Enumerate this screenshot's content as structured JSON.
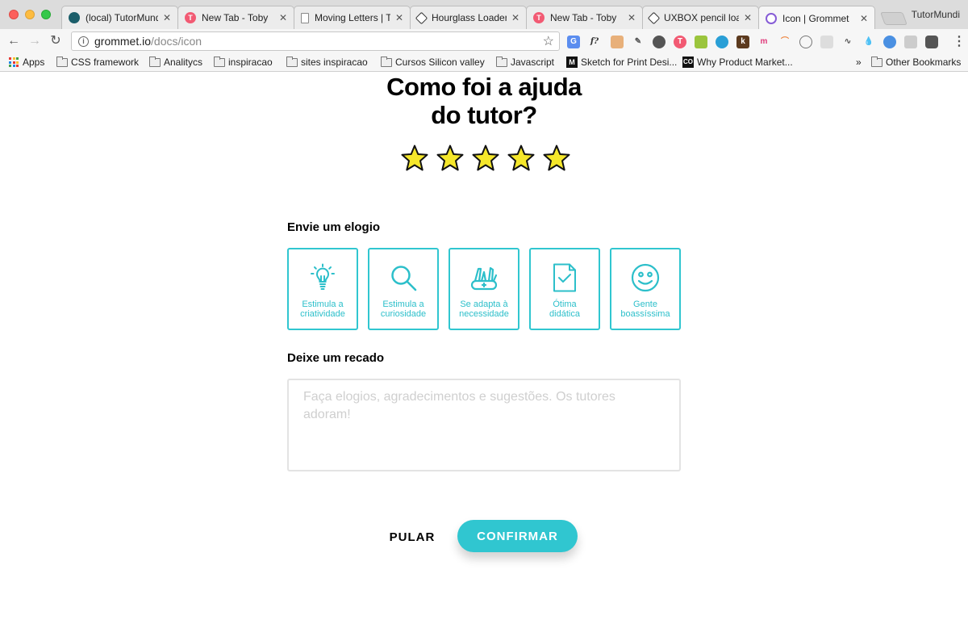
{
  "browser": {
    "tabs": [
      {
        "title": "(local) TutorMundi",
        "favicon_color": "#1b5e6a",
        "favicon": "tutormundi-favicon",
        "active": false
      },
      {
        "title": "New Tab - Toby",
        "favicon_color": "#f25a73",
        "favicon": "toby-favicon",
        "active": false
      },
      {
        "title": "Moving Letters | T",
        "favicon_color": "#888888",
        "favicon": "page-favicon",
        "active": false
      },
      {
        "title": "Hourglass Loader",
        "favicon_color": "#333333",
        "favicon": "codepen-favicon",
        "active": false
      },
      {
        "title": "New Tab - Toby",
        "favicon_color": "#f25a73",
        "favicon": "toby-favicon",
        "active": false
      },
      {
        "title": "UXBOX pencil loa",
        "favicon_color": "#333333",
        "favicon": "codepen-favicon",
        "active": false
      },
      {
        "title": "Icon | Grommet",
        "favicon_color": "#865cd6",
        "favicon": "grommet-favicon",
        "active": true
      }
    ],
    "profile_name": "TutorMundi",
    "url_host": "grommet.io",
    "url_path": "/docs/icon",
    "bookmarks": [
      {
        "label": "Apps",
        "icon": "apps-grid-icon"
      },
      {
        "label": "CSS framework",
        "icon": "folder-icon"
      },
      {
        "label": "Analitycs",
        "icon": "folder-icon"
      },
      {
        "label": "inspiracao",
        "icon": "folder-icon"
      },
      {
        "label": "sites inspiracao",
        "icon": "folder-icon"
      },
      {
        "label": "Cursos Silicon valley",
        "icon": "folder-icon"
      },
      {
        "label": "Javascript",
        "icon": "folder-icon"
      },
      {
        "label": "Sketch for Print Desi...",
        "icon": "medium-icon",
        "badge": "M"
      },
      {
        "label": "Why Product Market...",
        "icon": "co-icon",
        "badge": "CO"
      }
    ],
    "overflow": "»",
    "other_bookmarks": "Other Bookmarks"
  },
  "rating": {
    "heading_line1": "Como foi a ajuda",
    "heading_line2": "do tutor?",
    "stars": 5,
    "max_stars": 5,
    "star_color": "#f5e72b"
  },
  "compliments": {
    "label": "Envie um elogio",
    "accent_color": "#30c6d0",
    "items": [
      {
        "line1": "Estimula a",
        "line2": "criatividade",
        "icon": "lightbulb-icon"
      },
      {
        "line1": "Estimula a",
        "line2": "curiosidade",
        "icon": "search-icon"
      },
      {
        "line1": "Se adapta à",
        "line2": "necessidade",
        "icon": "swiss-knife-icon"
      },
      {
        "line1": "Ótima",
        "line2": "didática",
        "icon": "document-check-icon"
      },
      {
        "line1": "Gente",
        "line2": "boassíssima",
        "icon": "smiley-icon"
      }
    ]
  },
  "message": {
    "label": "Deixe um recado",
    "placeholder": "Faça elogios, agradecimentos e sugestões. Os tutores adoram!",
    "value": ""
  },
  "actions": {
    "skip_label": "PULAR",
    "confirm_label": "CONFIRMAR"
  }
}
